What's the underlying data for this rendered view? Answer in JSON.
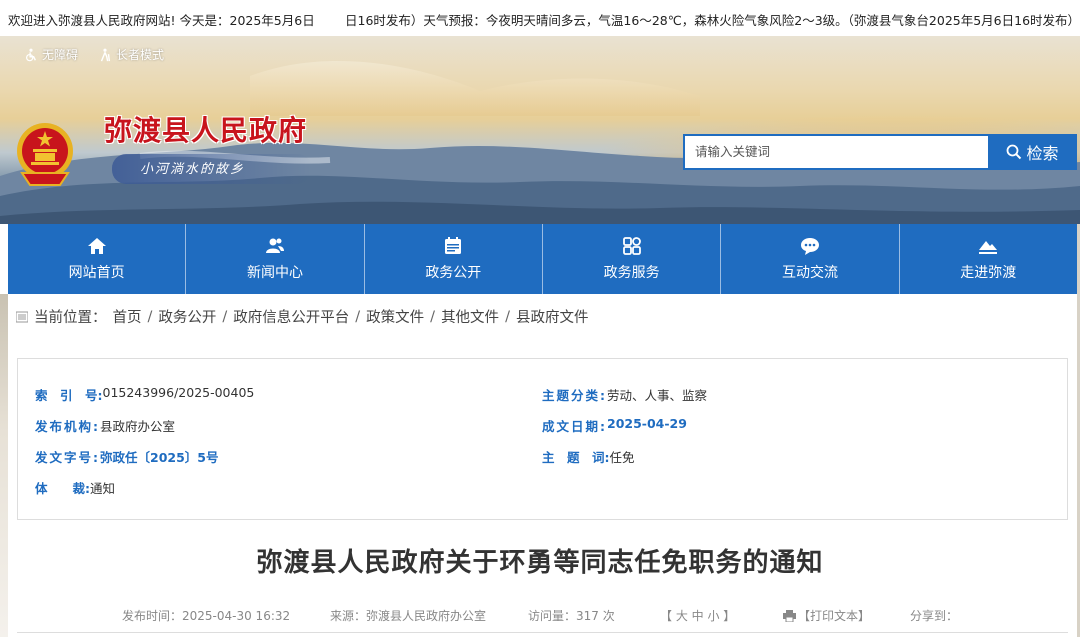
{
  "topbar": {
    "welcome": "欢迎进入弥渡县人民政府网站! 今天是：2025年5月6日",
    "weather": "日16时发布）天气预报：今夜明天晴间多云，气温16～28℃，森林火险气象风险2～3级。（弥渡县气象台2025年5月6日16时发布）"
  },
  "access": {
    "accessible_label": "无障碍",
    "elder_label": "长者模式"
  },
  "site": {
    "name": "弥渡县人民政府",
    "slogan": "小河淌水的故乡"
  },
  "search": {
    "placeholder": "请输入关键词",
    "button_label": "检索"
  },
  "nav": [
    {
      "label": "网站首页",
      "icon": "home-icon"
    },
    {
      "label": "新闻中心",
      "icon": "people-icon"
    },
    {
      "label": "政务公开",
      "icon": "calendar-icon"
    },
    {
      "label": "政务服务",
      "icon": "grid-icon"
    },
    {
      "label": "互动交流",
      "icon": "chat-icon"
    },
    {
      "label": "走进弥渡",
      "icon": "mountain-icon"
    }
  ],
  "breadcrumb": {
    "prefix": "当前位置：",
    "items": [
      "首页",
      "政务公开",
      "政府信息公开平台",
      "政策文件",
      "其他文件",
      "县政府文件"
    ],
    "separator": "/"
  },
  "info": {
    "index_key": "索　引　号:",
    "index_val": "015243996/2025-00405",
    "category_key": "主题分类:",
    "category_val": "劳动、人事、监察",
    "org_key": "发布机构:",
    "org_val": "县政府办公室",
    "date_key": "成文日期:",
    "date_val": "2025-04-29",
    "docno_key": "发文字号:",
    "docno_val": "弥政任〔2025〕5号",
    "subject_key": "主　题　词:",
    "subject_val": "任免",
    "genre_key": "体　　裁:",
    "genre_val": "通知"
  },
  "document": {
    "title": "弥渡县人民政府关于环勇等同志任免职务的通知"
  },
  "meta": {
    "publish_time": "发布时间：2025-04-30 16:32",
    "source": "来源：弥渡县人民政府办公室",
    "views": "访问量：317 次",
    "font_size": "【 大  中  小 】",
    "print": "【打印文本】",
    "share": "分享到："
  },
  "colors": {
    "brand_blue": "#1f6cc0",
    "site_name_red": "#c8141c"
  }
}
